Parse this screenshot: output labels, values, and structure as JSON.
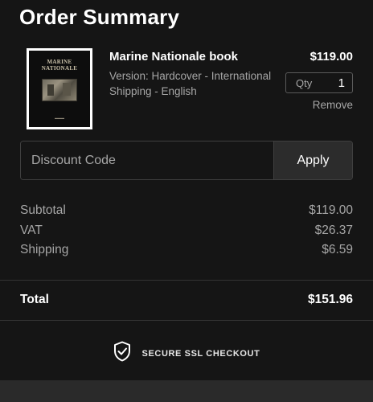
{
  "header": {
    "title": "Order Summary"
  },
  "product": {
    "cover_title": "MARINE NATIONALE",
    "name": "Marine Nationale book",
    "variant": "Version: Hardcover - International Shipping - English",
    "price": "$119.00",
    "qty_label": "Qty",
    "qty_value": "1",
    "remove_label": "Remove"
  },
  "discount": {
    "placeholder": "Discount Code",
    "apply_label": "Apply"
  },
  "summary": {
    "subtotal_label": "Subtotal",
    "subtotal_value": "$119.00",
    "vat_label": "VAT",
    "vat_value": "$26.37",
    "shipping_label": "Shipping",
    "shipping_value": "$6.59",
    "total_label": "Total",
    "total_value": "$151.96"
  },
  "secure": {
    "icon": "shield-check-icon",
    "label": "SECURE SSL CHECKOUT"
  }
}
